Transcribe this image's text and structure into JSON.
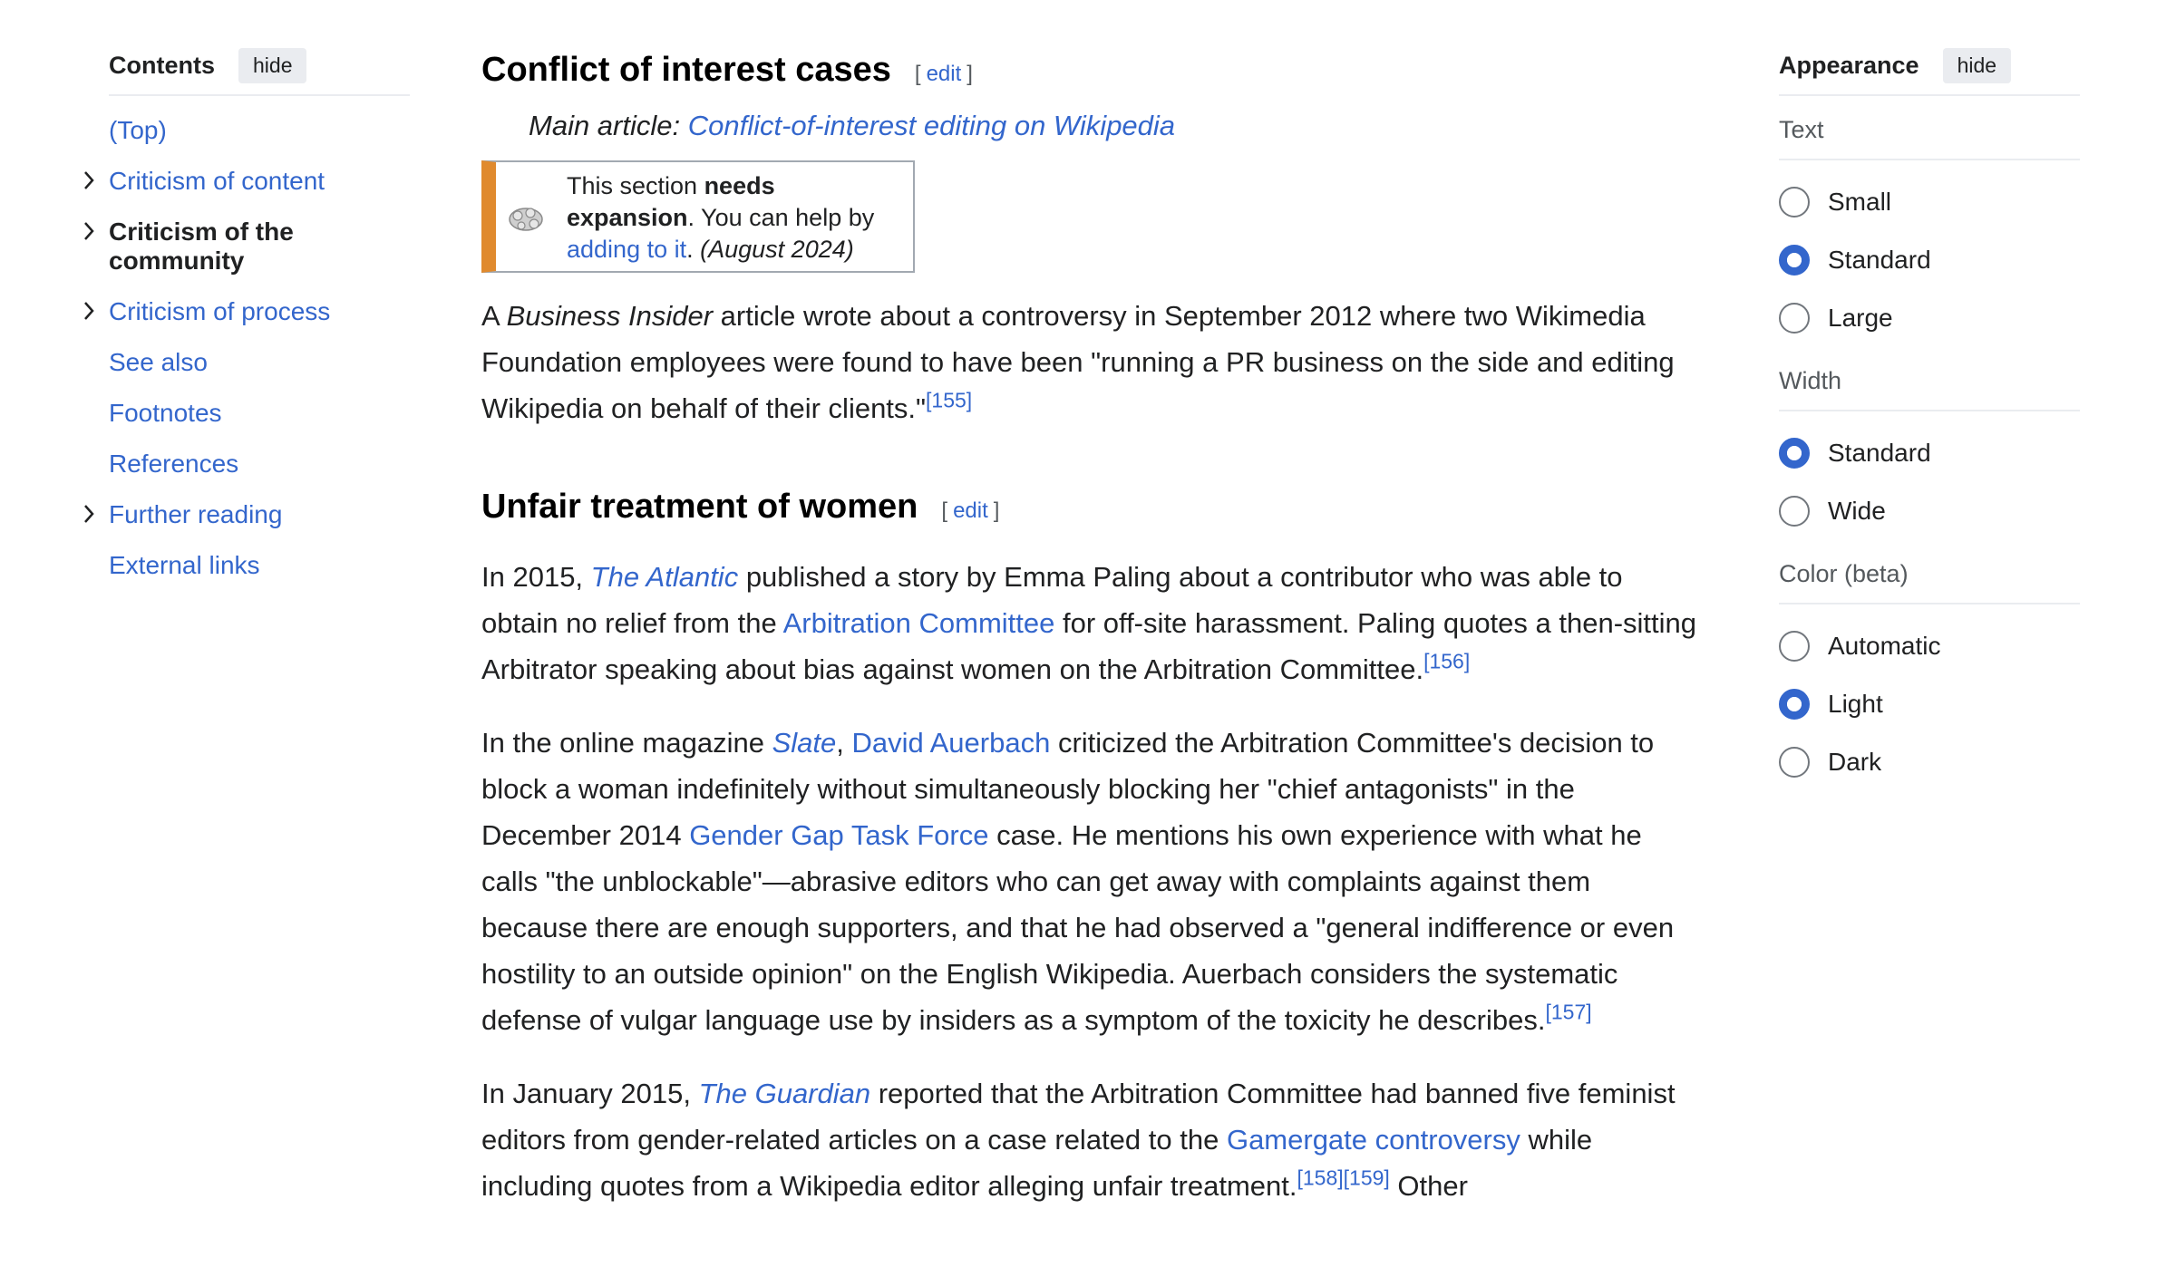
{
  "toc": {
    "title": "Contents",
    "hide_label": "hide",
    "items": [
      {
        "label": "(Top)",
        "expandable": false,
        "active": false
      },
      {
        "label": "Criticism of content",
        "expandable": true,
        "active": false
      },
      {
        "label": "Criticism of the community",
        "expandable": true,
        "active": true
      },
      {
        "label": "Criticism of process",
        "expandable": true,
        "active": false
      },
      {
        "label": "See also",
        "expandable": false,
        "active": false
      },
      {
        "label": "Footnotes",
        "expandable": false,
        "active": false
      },
      {
        "label": "References",
        "expandable": false,
        "active": false
      },
      {
        "label": "Further reading",
        "expandable": true,
        "active": false
      },
      {
        "label": "External links",
        "expandable": false,
        "active": false
      }
    ]
  },
  "section1": {
    "heading": "Conflict of interest cases",
    "edit_open": "[",
    "edit_label": "edit",
    "edit_close": "]",
    "hatnote_prefix": "Main article: ",
    "hatnote_link": "Conflict-of-interest editing on Wikipedia",
    "ambox": {
      "t1": "This section ",
      "bold": "needs expansion",
      "t2": ". You can help by ",
      "link": "adding to it",
      "t3": ". ",
      "date": "(August 2024)"
    },
    "p1": {
      "a": "A ",
      "italic": "Business Insider",
      "b": " article wrote about a controversy in September 2012 where two Wikimedia Foundation employees were found to have been \"running a PR business on the side and editing Wikipedia on behalf of their clients.\"",
      "ref": "[155]"
    }
  },
  "section2": {
    "heading": "Unfair treatment of women",
    "edit_open": "[",
    "edit_label": "edit",
    "edit_close": "]",
    "p1": {
      "a": "In 2015, ",
      "link1": "The Atlantic",
      "b": " published a story by Emma Paling about a contributor who was able to obtain no relief from the ",
      "link2": "Arbitration Committee",
      "c": " for off-site harassment. Paling quotes a then-sitting Arbitrator speaking about bias against women on the Arbitration Committee.",
      "ref": "[156]"
    },
    "p2": {
      "a": "In the online magazine ",
      "link1": "Slate",
      "b": ", ",
      "link2": "David Auerbach",
      "c": " criticized the Arbitration Committee's decision to block a woman indefinitely without simultaneously blocking her \"chief antagonists\" in the December 2014 ",
      "link3": "Gender Gap Task Force",
      "d": " case. He mentions his own experience with what he calls \"the unblockable\"—abrasive editors who can get away with complaints against them because there are enough supporters, and that he had observed a \"general indifference or even hostility to an outside opinion\" on the English Wikipedia. Auerbach considers the systematic defense of vulgar language use by insiders as a symptom of the toxicity he describes.",
      "ref": "[157]"
    },
    "p3": {
      "a": "In January 2015, ",
      "link1": "The Guardian",
      "b": " reported that the Arbitration Committee had banned five feminist editors from gender-related articles on a case related to the ",
      "link2": "Gamergate controversy",
      "c": " while including quotes from a Wikipedia editor alleging unfair treatment.",
      "ref1": "[158]",
      "ref2": "[159]",
      "d": " Other"
    }
  },
  "appearance": {
    "title": "Appearance",
    "hide_label": "hide",
    "text_label": "Text",
    "text_options": [
      {
        "label": "Small",
        "checked": false
      },
      {
        "label": "Standard",
        "checked": true
      },
      {
        "label": "Large",
        "checked": false
      }
    ],
    "width_label": "Width",
    "width_options": [
      {
        "label": "Standard",
        "checked": true
      },
      {
        "label": "Wide",
        "checked": false
      }
    ],
    "color_label": "Color (beta)",
    "color_options": [
      {
        "label": "Automatic",
        "checked": false
      },
      {
        "label": "Light",
        "checked": true
      },
      {
        "label": "Dark",
        "checked": false
      }
    ]
  },
  "colors": {
    "link": "#3366cc",
    "accent": "#3366cc",
    "ambox_stripe": "#e08a2e"
  }
}
